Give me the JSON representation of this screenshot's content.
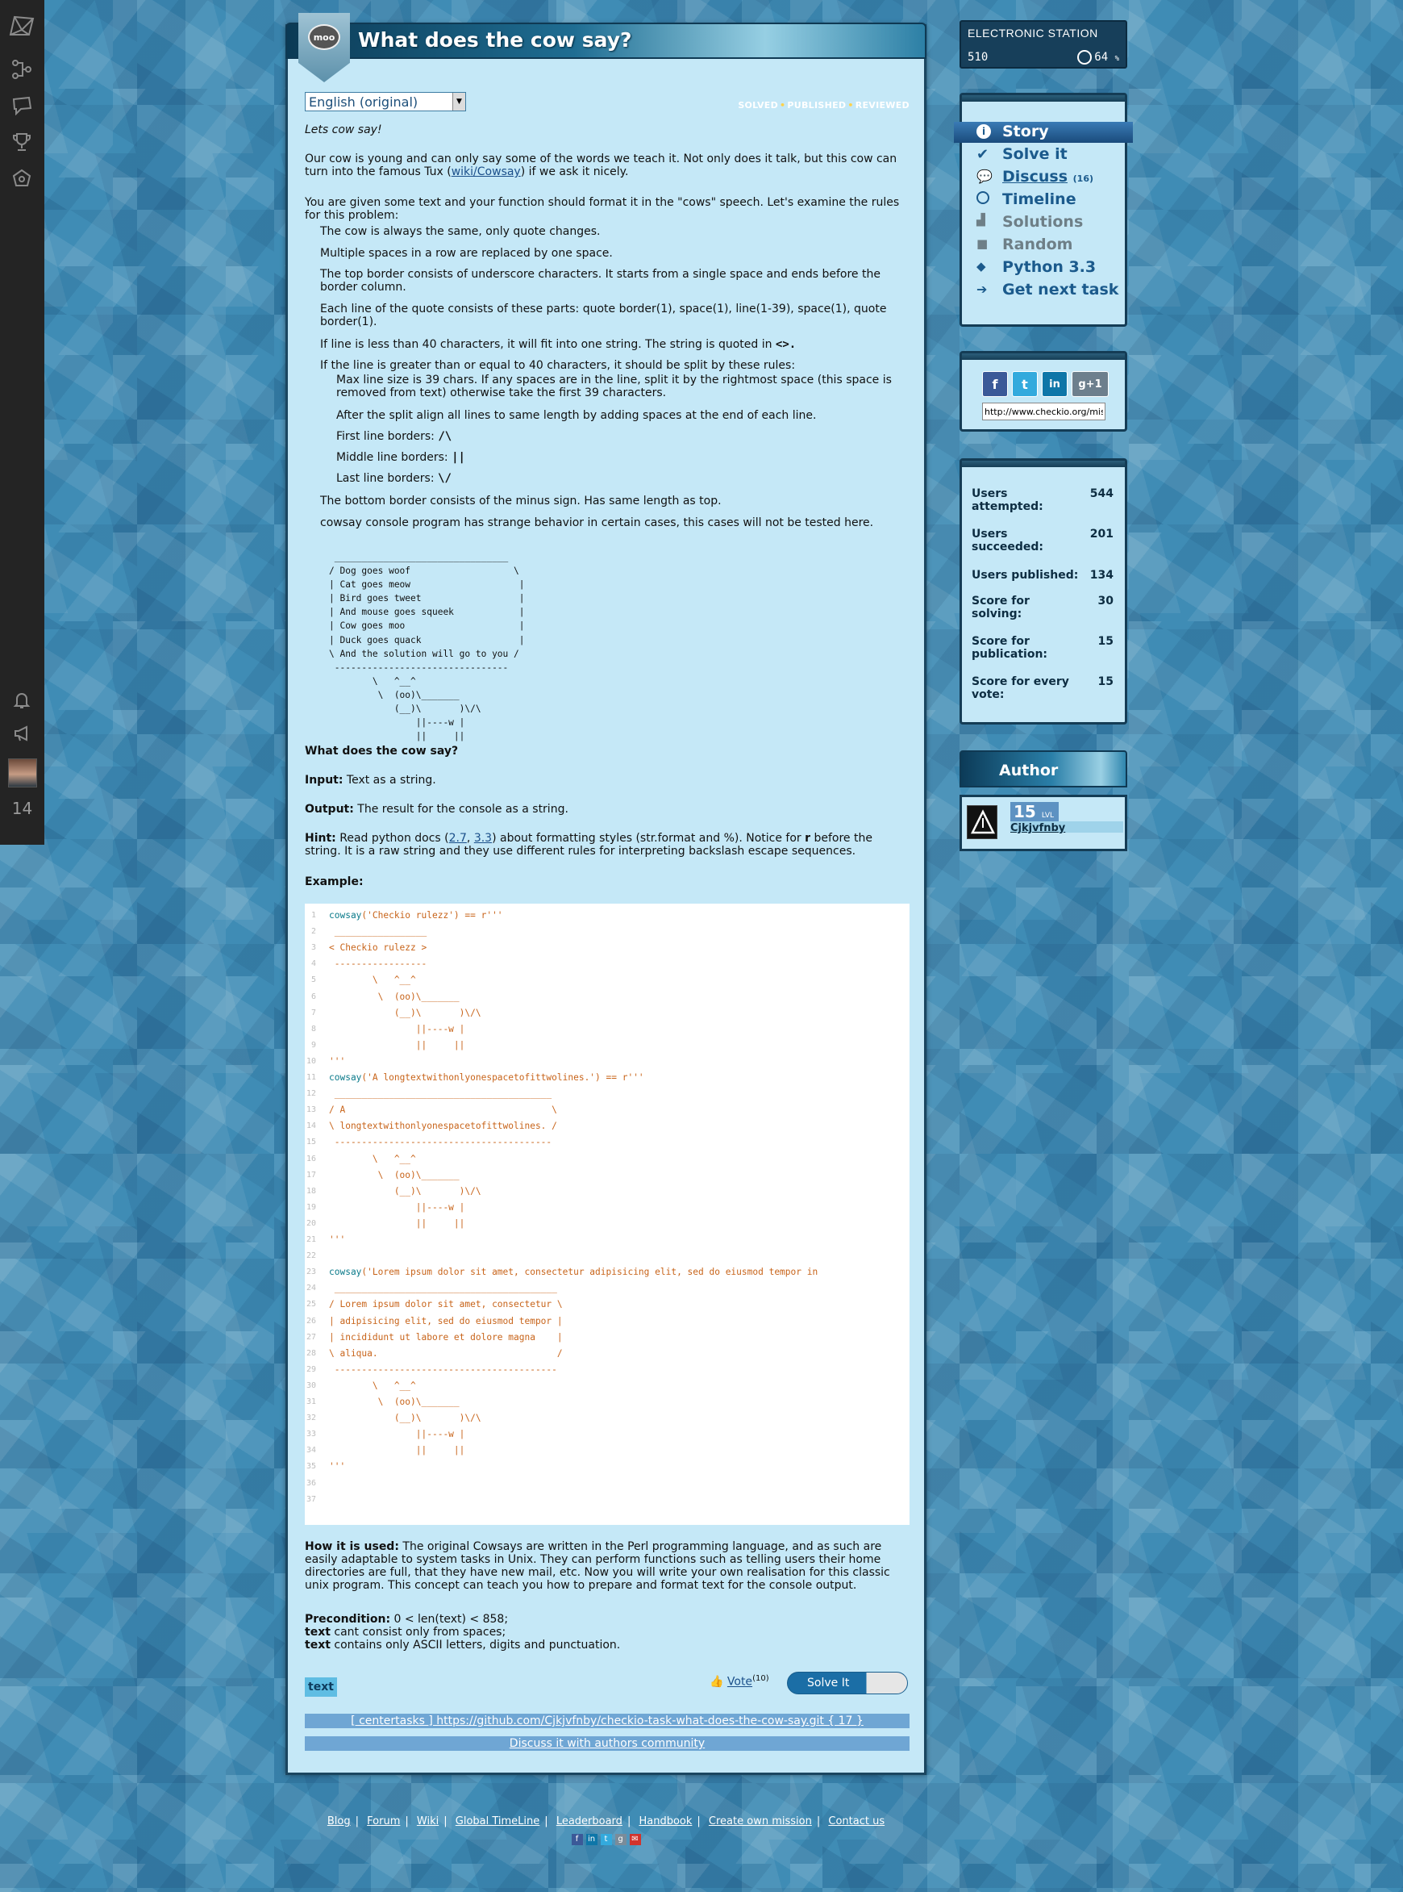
{
  "sidebar": {
    "notification_count": "14"
  },
  "header": {
    "title": "What does the cow say?",
    "badge_text": "moo"
  },
  "language": {
    "selected": "English (original)"
  },
  "status_flags": [
    "SOLVED",
    "PUBLISHED",
    "REVIEWED"
  ],
  "story": {
    "intro": "Lets cow say!",
    "p1_before": "Our cow is young and can only say some of the words we teach it. Not only does it talk, but this cow can turn into the famous Tux (",
    "p1_link": "wiki/Cowsay",
    "p1_after": ") if we ask it nicely.",
    "p2": "You are given some text and your function should format it in the \"cows\" speech. Let's examine the rules for this problem:",
    "rules": [
      "The cow is always the same, only quote changes.",
      "Multiple spaces in a row are replaced by one space.",
      "The top border consists of underscore characters. It starts from a single space and ends before the border column.",
      "Each line of the quote consists of these parts: quote border(1), space(1), line(1-39), space(1), quote border(1).",
      "If line is less than 40 characters, it will fit into one string. The string is quoted in",
      "If the line is greater than or equal to 40 characters, it should be split by these rules:"
    ],
    "rule5_code": "<>.",
    "subrules": [
      "Max line size is 39 chars. If any spaces are in the line, split it by the rightmost space (this space is removed from text) otherwise take the first 39 characters.",
      "After the split align all lines to same length by adding spaces at the end of each line.",
      "First line borders:",
      "Middle line borders:",
      "Last line borders:"
    ],
    "subrule_codes": [
      "/\\",
      "||",
      "\\/"
    ],
    "rules_after": [
      "The bottom border consists of the minus sign. Has same length as top.",
      "cowsay console program has strange behavior in certain cases, this cases will not be tested here."
    ],
    "ascii_art": " ________________________________\n/ Dog goes woof                   \\\n| Cat goes meow                    |\n| Bird goes tweet                  |\n| And mouse goes squeek            |\n| Cow goes moo                     |\n| Duck goes quack                  |\n\\ And the solution will go to you /\n --------------------------------\n        \\   ^__^\n         \\  (oo)\\_______\n            (__)\\       )\\/\\\n                ||----w |\n                ||     ||",
    "question": "What does the cow say?",
    "input_label": "Input:",
    "input_text": "Text as a string.",
    "output_label": "Output:",
    "output_text": "The result for the console as a string.",
    "hint_label": "Hint:",
    "hint_a": "Read python docs (",
    "hint_link1": "2.7",
    "hint_sep": ", ",
    "hint_link2": "3.3",
    "hint_b": ") about formatting styles (str.format and %). Notice for",
    "hint_r": "r",
    "hint_c": "before the string. It is a raw string and they use different rules for interpreting backslash escape sequences.",
    "example_label": "Example:",
    "code_lines": [
      "cowsay('Checkio rulezz') == r'''",
      " _________________",
      "< Checkio rulezz >",
      " -----------------",
      "        \\   ^__^",
      "         \\  (oo)\\_______",
      "            (__)\\       )\\/\\",
      "                ||----w |",
      "                ||     ||",
      "'''",
      "cowsay('A longtextwithonlyonespacetofittwolines.') == r'''",
      " ________________________________________",
      "/ A                                      \\",
      "\\ longtextwithonlyonespacetofittwolines. /",
      " ----------------------------------------",
      "        \\   ^__^",
      "         \\  (oo)\\_______",
      "            (__)\\       )\\/\\",
      "                ||----w |",
      "                ||     ||",
      "'''",
      "",
      "cowsay('Lorem ipsum dolor sit amet, consectetur adipisicing elit, sed do eiusmod tempor in",
      " _________________________________________",
      "/ Lorem ipsum dolor sit amet, consectetur \\",
      "| adipisicing elit, sed do eiusmod tempor |",
      "| incididunt ut labore et dolore magna    |",
      "\\ aliqua.                                 /",
      " -----------------------------------------",
      "        \\   ^__^",
      "         \\  (oo)\\_______",
      "            (__)\\       )\\/\\",
      "                ||----w |",
      "                ||     ||",
      "'''",
      "",
      ""
    ],
    "used_label": "How it is used:",
    "used_text": "The original Cowsays are written in the Perl programming language, and as such are easily adaptable to system tasks in Unix. They can perform functions such as telling users their home directories are full, that they have new mail, etc. Now you will write your own realisation for this classic unix program. This concept can teach you how to prepare and format text for the console output.",
    "pre_label": "Precondition:",
    "pre_text": "0 < len(text) < 858;",
    "pre_l2_bold": "text",
    "pre_l2": "cant consist only from spaces;",
    "pre_l3_bold": "text",
    "pre_l3": "contains only ASCII letters, digits and punctuation."
  },
  "tag": "text",
  "vote": {
    "label": "Vote",
    "count": "(10)"
  },
  "solve_button": "Solve It",
  "repo_link": "[ centertasks ] https://github.com/Cjkjvfnby/checkio-task-what-does-the-cow-say.git { 17 }",
  "discuss_link": "Discuss it with authors community",
  "footer": {
    "links": [
      "Blog",
      "Forum",
      "Wiki",
      "Global TimeLine",
      "Leaderboard",
      "Handbook",
      "Create own mission",
      "Contact us"
    ],
    "separator": "|"
  },
  "station": {
    "name": "ELECTRONIC STATION",
    "points": "510",
    "percent": "64",
    "percent_unit": "%"
  },
  "menu": [
    {
      "label": "Story",
      "icon": "info-icon"
    },
    {
      "label": "Solve it",
      "icon": "check-icon"
    },
    {
      "label": "Discuss",
      "count": "(16)",
      "icon": "comments-icon"
    },
    {
      "label": "Timeline",
      "icon": "clock-icon"
    },
    {
      "label": "Solutions",
      "icon": "podium-icon"
    },
    {
      "label": "Random",
      "icon": "box-icon"
    },
    {
      "label": "Python 3.3",
      "icon": "python-icon"
    },
    {
      "label": "Get next task",
      "icon": "arrow-right-icon"
    }
  ],
  "share": {
    "url": "http://www.checkio.org/mis",
    "buttons": [
      "f",
      "t",
      "in",
      "g+1"
    ]
  },
  "stats": [
    {
      "label": "Users attempted:",
      "value": "544"
    },
    {
      "label": "Users succeeded:",
      "value": "201"
    },
    {
      "label": "Users published:",
      "value": "134"
    },
    {
      "label": "Score for solving:",
      "value": "30"
    },
    {
      "label": "Score for publication:",
      "value": "15"
    },
    {
      "label": "Score for every vote:",
      "value": "15"
    }
  ],
  "author": {
    "heading": "Author",
    "level": "15",
    "level_unit": "LVL",
    "name": "Cjkjvfnby"
  },
  "colors": {
    "panel_bg": "#c5e8f7",
    "panel_border": "#1b4660",
    "link": "#1b4f8a",
    "accent_orange": "#c8641a"
  }
}
